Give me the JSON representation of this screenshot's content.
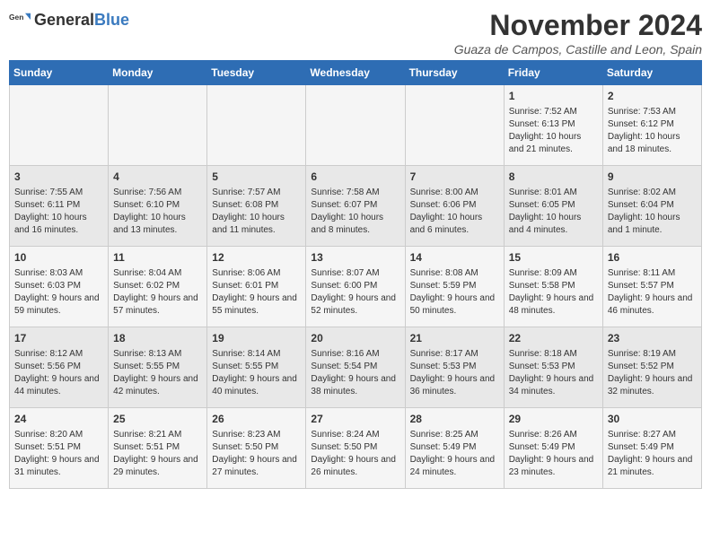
{
  "logo": {
    "general": "General",
    "blue": "Blue"
  },
  "title": {
    "month_year": "November 2024",
    "location": "Guaza de Campos, Castille and Leon, Spain"
  },
  "headers": [
    "Sunday",
    "Monday",
    "Tuesday",
    "Wednesday",
    "Thursday",
    "Friday",
    "Saturday"
  ],
  "weeks": [
    [
      {
        "day": "",
        "info": ""
      },
      {
        "day": "",
        "info": ""
      },
      {
        "day": "",
        "info": ""
      },
      {
        "day": "",
        "info": ""
      },
      {
        "day": "",
        "info": ""
      },
      {
        "day": "1",
        "info": "Sunrise: 7:52 AM\nSunset: 6:13 PM\nDaylight: 10 hours and 21 minutes."
      },
      {
        "day": "2",
        "info": "Sunrise: 7:53 AM\nSunset: 6:12 PM\nDaylight: 10 hours and 18 minutes."
      }
    ],
    [
      {
        "day": "3",
        "info": "Sunrise: 7:55 AM\nSunset: 6:11 PM\nDaylight: 10 hours and 16 minutes."
      },
      {
        "day": "4",
        "info": "Sunrise: 7:56 AM\nSunset: 6:10 PM\nDaylight: 10 hours and 13 minutes."
      },
      {
        "day": "5",
        "info": "Sunrise: 7:57 AM\nSunset: 6:08 PM\nDaylight: 10 hours and 11 minutes."
      },
      {
        "day": "6",
        "info": "Sunrise: 7:58 AM\nSunset: 6:07 PM\nDaylight: 10 hours and 8 minutes."
      },
      {
        "day": "7",
        "info": "Sunrise: 8:00 AM\nSunset: 6:06 PM\nDaylight: 10 hours and 6 minutes."
      },
      {
        "day": "8",
        "info": "Sunrise: 8:01 AM\nSunset: 6:05 PM\nDaylight: 10 hours and 4 minutes."
      },
      {
        "day": "9",
        "info": "Sunrise: 8:02 AM\nSunset: 6:04 PM\nDaylight: 10 hours and 1 minute."
      }
    ],
    [
      {
        "day": "10",
        "info": "Sunrise: 8:03 AM\nSunset: 6:03 PM\nDaylight: 9 hours and 59 minutes."
      },
      {
        "day": "11",
        "info": "Sunrise: 8:04 AM\nSunset: 6:02 PM\nDaylight: 9 hours and 57 minutes."
      },
      {
        "day": "12",
        "info": "Sunrise: 8:06 AM\nSunset: 6:01 PM\nDaylight: 9 hours and 55 minutes."
      },
      {
        "day": "13",
        "info": "Sunrise: 8:07 AM\nSunset: 6:00 PM\nDaylight: 9 hours and 52 minutes."
      },
      {
        "day": "14",
        "info": "Sunrise: 8:08 AM\nSunset: 5:59 PM\nDaylight: 9 hours and 50 minutes."
      },
      {
        "day": "15",
        "info": "Sunrise: 8:09 AM\nSunset: 5:58 PM\nDaylight: 9 hours and 48 minutes."
      },
      {
        "day": "16",
        "info": "Sunrise: 8:11 AM\nSunset: 5:57 PM\nDaylight: 9 hours and 46 minutes."
      }
    ],
    [
      {
        "day": "17",
        "info": "Sunrise: 8:12 AM\nSunset: 5:56 PM\nDaylight: 9 hours and 44 minutes."
      },
      {
        "day": "18",
        "info": "Sunrise: 8:13 AM\nSunset: 5:55 PM\nDaylight: 9 hours and 42 minutes."
      },
      {
        "day": "19",
        "info": "Sunrise: 8:14 AM\nSunset: 5:55 PM\nDaylight: 9 hours and 40 minutes."
      },
      {
        "day": "20",
        "info": "Sunrise: 8:16 AM\nSunset: 5:54 PM\nDaylight: 9 hours and 38 minutes."
      },
      {
        "day": "21",
        "info": "Sunrise: 8:17 AM\nSunset: 5:53 PM\nDaylight: 9 hours and 36 minutes."
      },
      {
        "day": "22",
        "info": "Sunrise: 8:18 AM\nSunset: 5:53 PM\nDaylight: 9 hours and 34 minutes."
      },
      {
        "day": "23",
        "info": "Sunrise: 8:19 AM\nSunset: 5:52 PM\nDaylight: 9 hours and 32 minutes."
      }
    ],
    [
      {
        "day": "24",
        "info": "Sunrise: 8:20 AM\nSunset: 5:51 PM\nDaylight: 9 hours and 31 minutes."
      },
      {
        "day": "25",
        "info": "Sunrise: 8:21 AM\nSunset: 5:51 PM\nDaylight: 9 hours and 29 minutes."
      },
      {
        "day": "26",
        "info": "Sunrise: 8:23 AM\nSunset: 5:50 PM\nDaylight: 9 hours and 27 minutes."
      },
      {
        "day": "27",
        "info": "Sunrise: 8:24 AM\nSunset: 5:50 PM\nDaylight: 9 hours and 26 minutes."
      },
      {
        "day": "28",
        "info": "Sunrise: 8:25 AM\nSunset: 5:49 PM\nDaylight: 9 hours and 24 minutes."
      },
      {
        "day": "29",
        "info": "Sunrise: 8:26 AM\nSunset: 5:49 PM\nDaylight: 9 hours and 23 minutes."
      },
      {
        "day": "30",
        "info": "Sunrise: 8:27 AM\nSunset: 5:49 PM\nDaylight: 9 hours and 21 minutes."
      }
    ]
  ]
}
